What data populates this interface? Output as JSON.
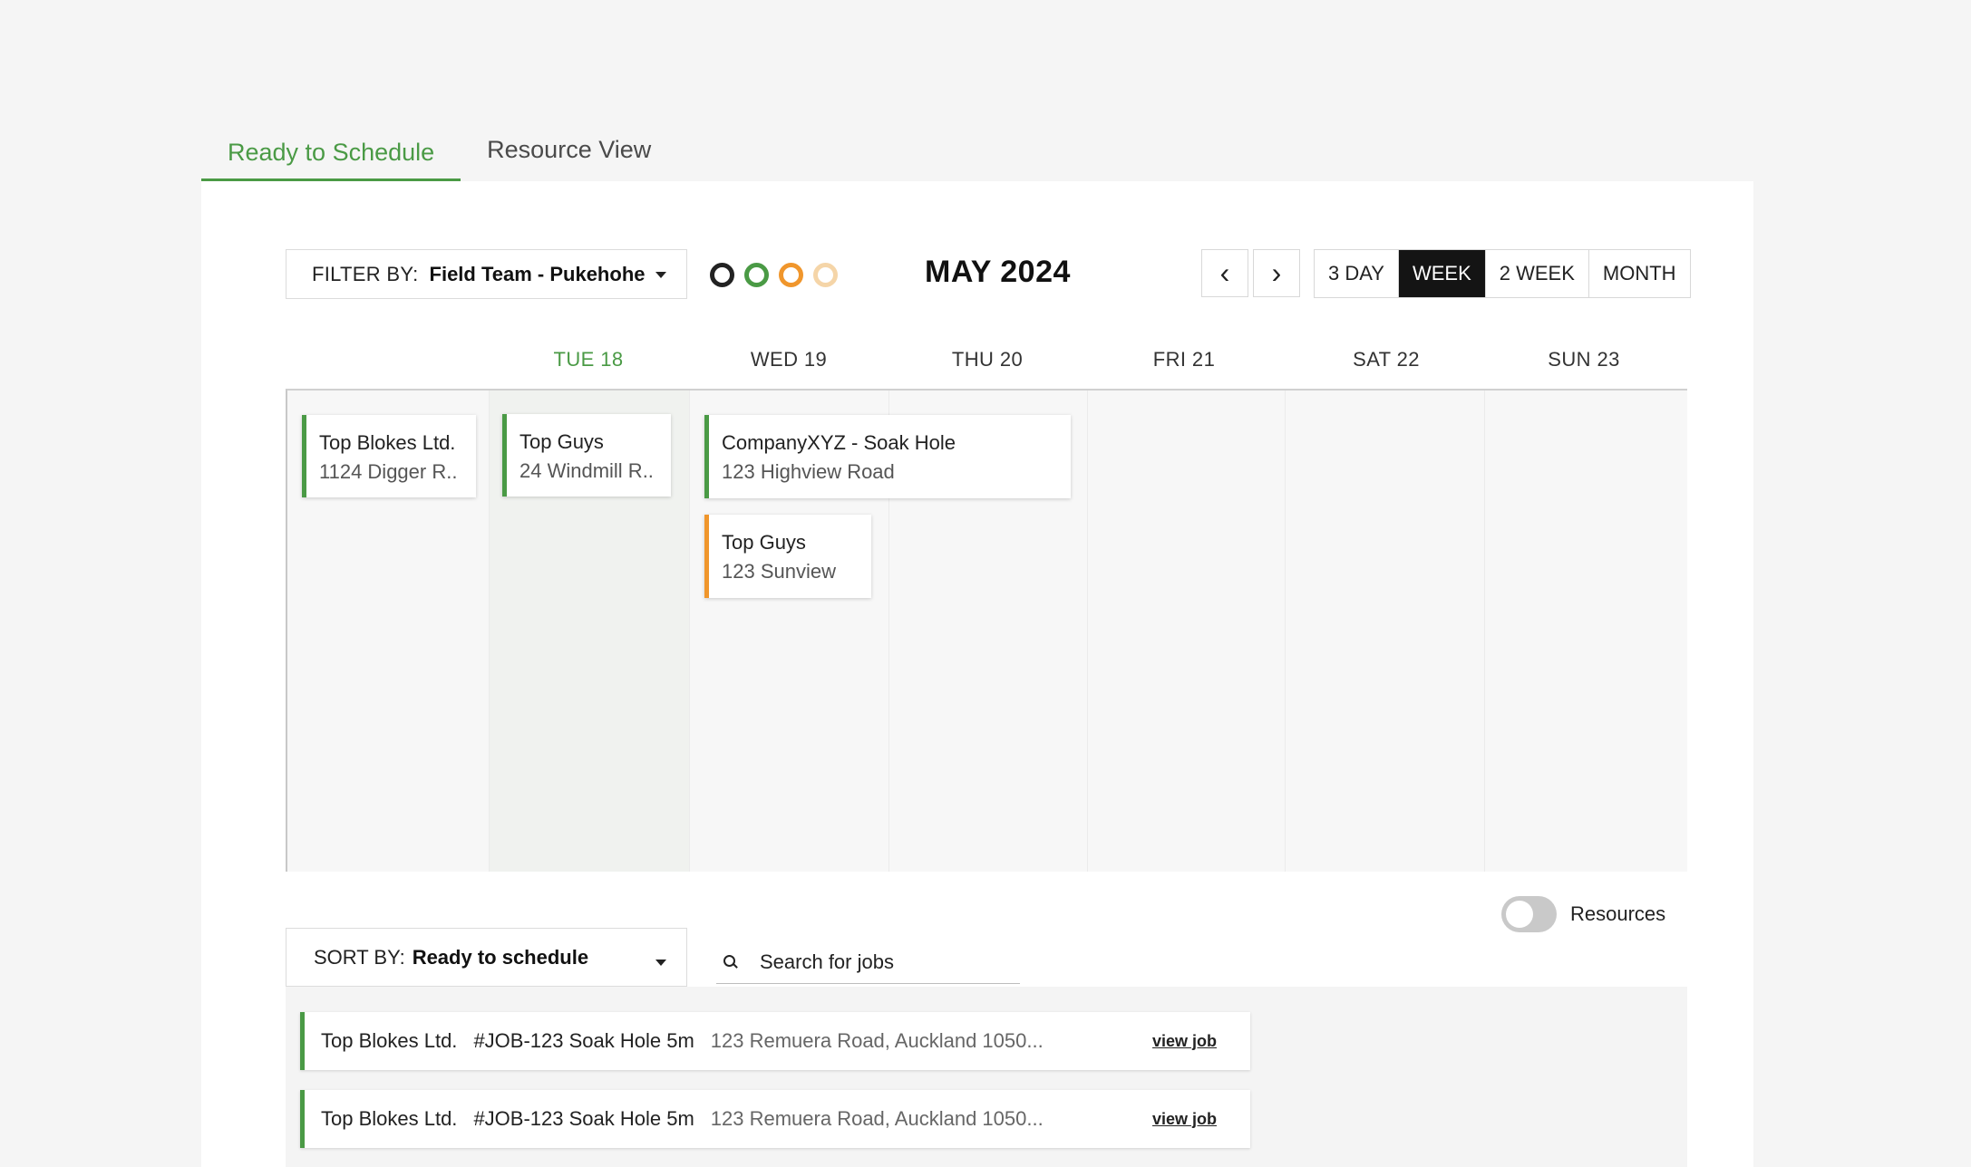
{
  "tabs": [
    {
      "label": "Ready to Schedule",
      "active": true
    },
    {
      "label": "Resource View",
      "active": false
    }
  ],
  "filter": {
    "label": "FILTER BY:",
    "value": "Field Team - Pukehohe"
  },
  "legend_colors": [
    "#222222",
    "#4a9a45",
    "#f0962c",
    "#f5d5a8"
  ],
  "month_label": "MAY 2024",
  "nav": {
    "prev_icon": "chevron-left-icon",
    "next_icon": "chevron-right-icon",
    "prev_glyph": "‹",
    "next_glyph": "›"
  },
  "view_options": [
    {
      "label": "3 DAY",
      "active": false
    },
    {
      "label": "WEEK",
      "active": true
    },
    {
      "label": "2 WEEK",
      "active": false
    },
    {
      "label": "MONTH",
      "active": false
    }
  ],
  "days": [
    {
      "label": "TUE 18",
      "today": true
    },
    {
      "label": "WED 19",
      "today": false
    },
    {
      "label": "THU 20",
      "today": false
    },
    {
      "label": "FRI 21",
      "today": false
    },
    {
      "label": "SAT 22",
      "today": false
    },
    {
      "label": "SUN 23",
      "today": false
    }
  ],
  "events": [
    {
      "title": "Top Blokes Ltd.",
      "address": "1124 Digger R..",
      "status": "green"
    },
    {
      "title": "Top Guys",
      "address": "24 Windmill R..",
      "status": "green"
    },
    {
      "title": "CompanyXYZ - Soak Hole",
      "address": "123 Highview Road",
      "status": "green"
    },
    {
      "title": "Top Guys",
      "address": "123 Sunview",
      "status": "orange"
    }
  ],
  "resources_toggle": {
    "label": "Resources",
    "on": false
  },
  "sort": {
    "label": "SORT BY:",
    "value": "Ready to schedule"
  },
  "search": {
    "placeholder": "Search for jobs",
    "value": ""
  },
  "jobs": [
    {
      "client": "Top Blokes Ltd.",
      "job": "#JOB-123 Soak Hole 5m",
      "address": "123 Remuera Road, Auckland 1050...",
      "link": "view job"
    },
    {
      "client": "Top Blokes Ltd.",
      "job": "#JOB-123 Soak Hole 5m",
      "address": "123 Remuera Road, Auckland 1050...",
      "link": "view job"
    }
  ]
}
